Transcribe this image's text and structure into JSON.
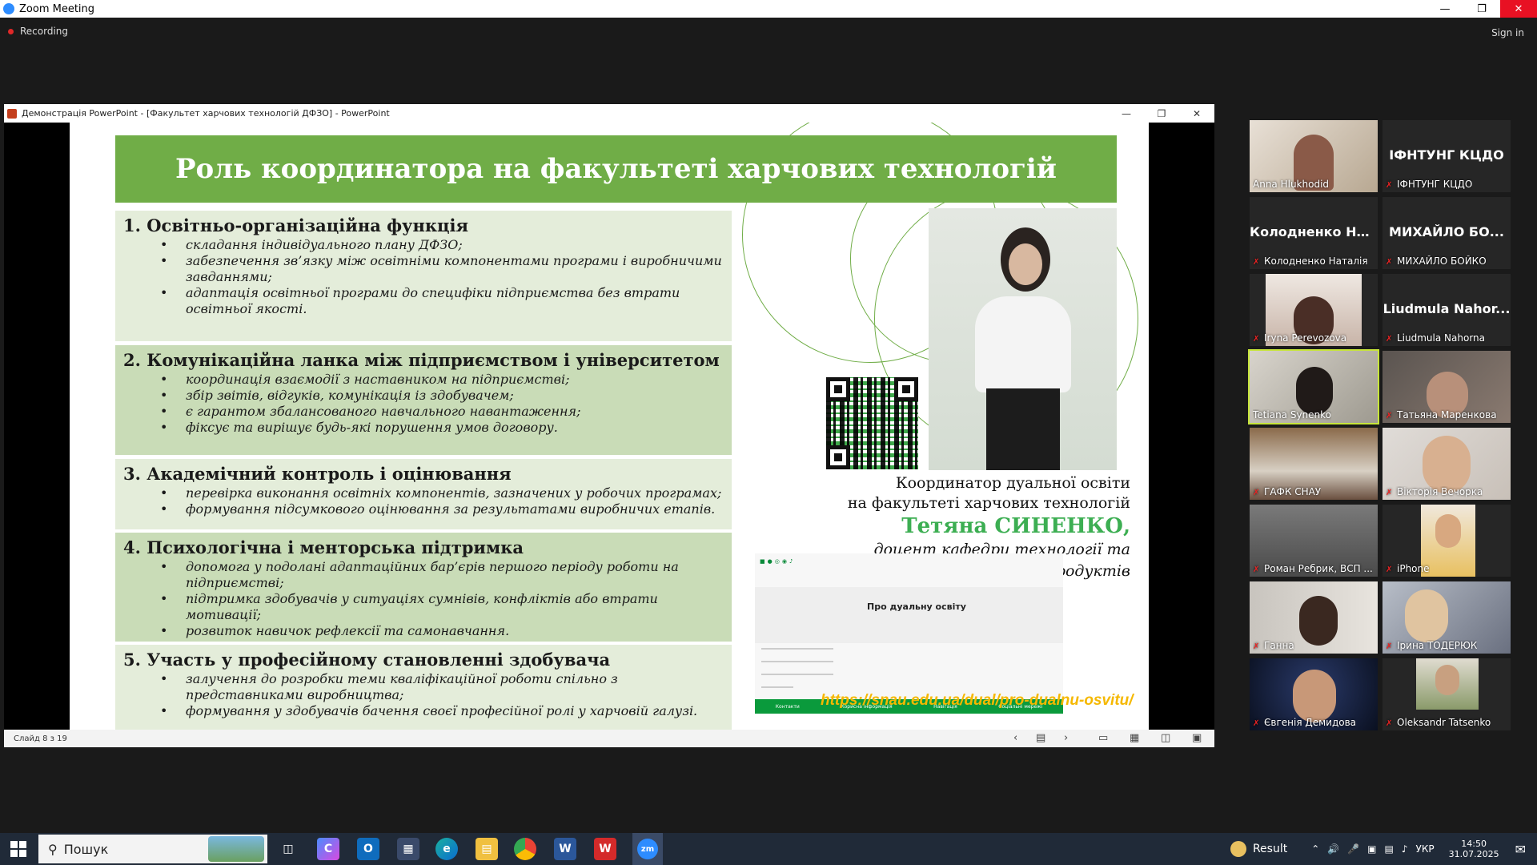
{
  "window": {
    "title": "Zoom Meeting"
  },
  "zoom": {
    "recording_label": "Recording",
    "sign_in": "Sign in"
  },
  "ppt": {
    "title": "Демонстрація PowerPoint - [Факультет харчових технологій ДФЗО] - PowerPoint",
    "status": "Слайд 8 з 19"
  },
  "slide": {
    "header": "Роль координатора на факультеті харчових технологій",
    "sections": [
      {
        "title": "1. Освітньо-організаційна функція",
        "items": [
          "складання індивідуального плану ДФЗО;",
          "забезпечення зв’язку між освітніми компонентами програми і виробничими завданнями;",
          "адаптація освітньої програми до специфіки підприємства без втрати освітньої якості."
        ]
      },
      {
        "title": "2. Комунікаційна ланка між підприємством і університетом",
        "items": [
          "координація взаємодії з наставником на підприємстві;",
          "збір звітів, відгуків, комунікація із здобувачем;",
          "є гарантом збалансованого навчального навантаження;",
          "фіксує та вирішує будь-які порушення умов договору."
        ]
      },
      {
        "title": "3. Академічний контроль і оцінювання",
        "items": [
          "перевірка виконання освітніх компонентів, зазначених у робочих програмах;",
          "формування підсумкового оцінювання за результатами виробничих етапів."
        ]
      },
      {
        "title": "4. Психологічна і менторська підтримка",
        "items": [
          "допомога у подолані адаптаційних бар’єрів першого періоду роботи на підприємстві;",
          "підтримка здобувачів у ситуаціях сумнівів, конфліктів або втрати мотивації;",
          "розвиток навичок рефлексії та самонавчання."
        ]
      },
      {
        "title": "5. Участь у професійному становленні здобувача",
        "items": [
          "залучення до розробки теми кваліфікаційної роботи спільно з представниками виробництва;",
          "формування у здобувачів бачення своєї професійної ролі у харчовій галузі."
        ]
      }
    ],
    "coordinator": {
      "line1": "Координатор дуальної освіти",
      "line2": "на факультеті харчових технологій",
      "name": "Тетяна СИНЕНКО,",
      "pos1": "доцент кафедри технології та",
      "pos2": "безпечності харчових продуктів"
    },
    "web": {
      "title": "Про дуальну освіту",
      "footer": [
        "Контакти",
        "Корисна інформація",
        "Навігація",
        "Соціальні мережі"
      ]
    },
    "url": "https://snau.edu.ua/dual/pro-dualnu-osvitu/"
  },
  "participants": [
    {
      "name": "Anna Hlukhodid",
      "video": true
    },
    {
      "name": "ІФНТУНГ КЦДО",
      "video": false,
      "big": "ІФНТУНГ КЦДО",
      "muted": true
    },
    {
      "name": "Колодненко Наталія",
      "video": false,
      "big": "Колодненко  На...",
      "muted": true
    },
    {
      "name": "МИХАЙЛО БОЙКО",
      "video": false,
      "big": "МИХАЙЛО  БО...",
      "muted": true
    },
    {
      "name": "Iryna Perevozova",
      "video": true,
      "muted": true
    },
    {
      "name": "Liudmula Nahorna",
      "video": false,
      "big": "Liudmula  Nahor...",
      "muted": true
    },
    {
      "name": "Tetiana Synenko",
      "video": true,
      "active": true
    },
    {
      "name": "Татьяна Маренкова",
      "video": true,
      "muted": true
    },
    {
      "name": "ГАФК СНАУ",
      "video": true,
      "muted": true
    },
    {
      "name": "Вікторія Вечорка",
      "video": true,
      "muted": true
    },
    {
      "name": "Роман Ребрик, ВСП ...",
      "video": true,
      "muted": true
    },
    {
      "name": "iPhone",
      "video": true,
      "muted": true
    },
    {
      "name": "Ганна",
      "video": true,
      "muted": true
    },
    {
      "name": "Ірина ТОДЕРЮК",
      "video": true,
      "muted": true
    },
    {
      "name": "Євгенія Демидова",
      "video": true,
      "muted": true
    },
    {
      "name": "Oleksandr Tatsenko",
      "video": true,
      "muted": true
    }
  ],
  "taskbar": {
    "search": "Пошук",
    "weather": "Result",
    "lang": "УКР",
    "time": "14:50",
    "date": "31.07.2025"
  }
}
